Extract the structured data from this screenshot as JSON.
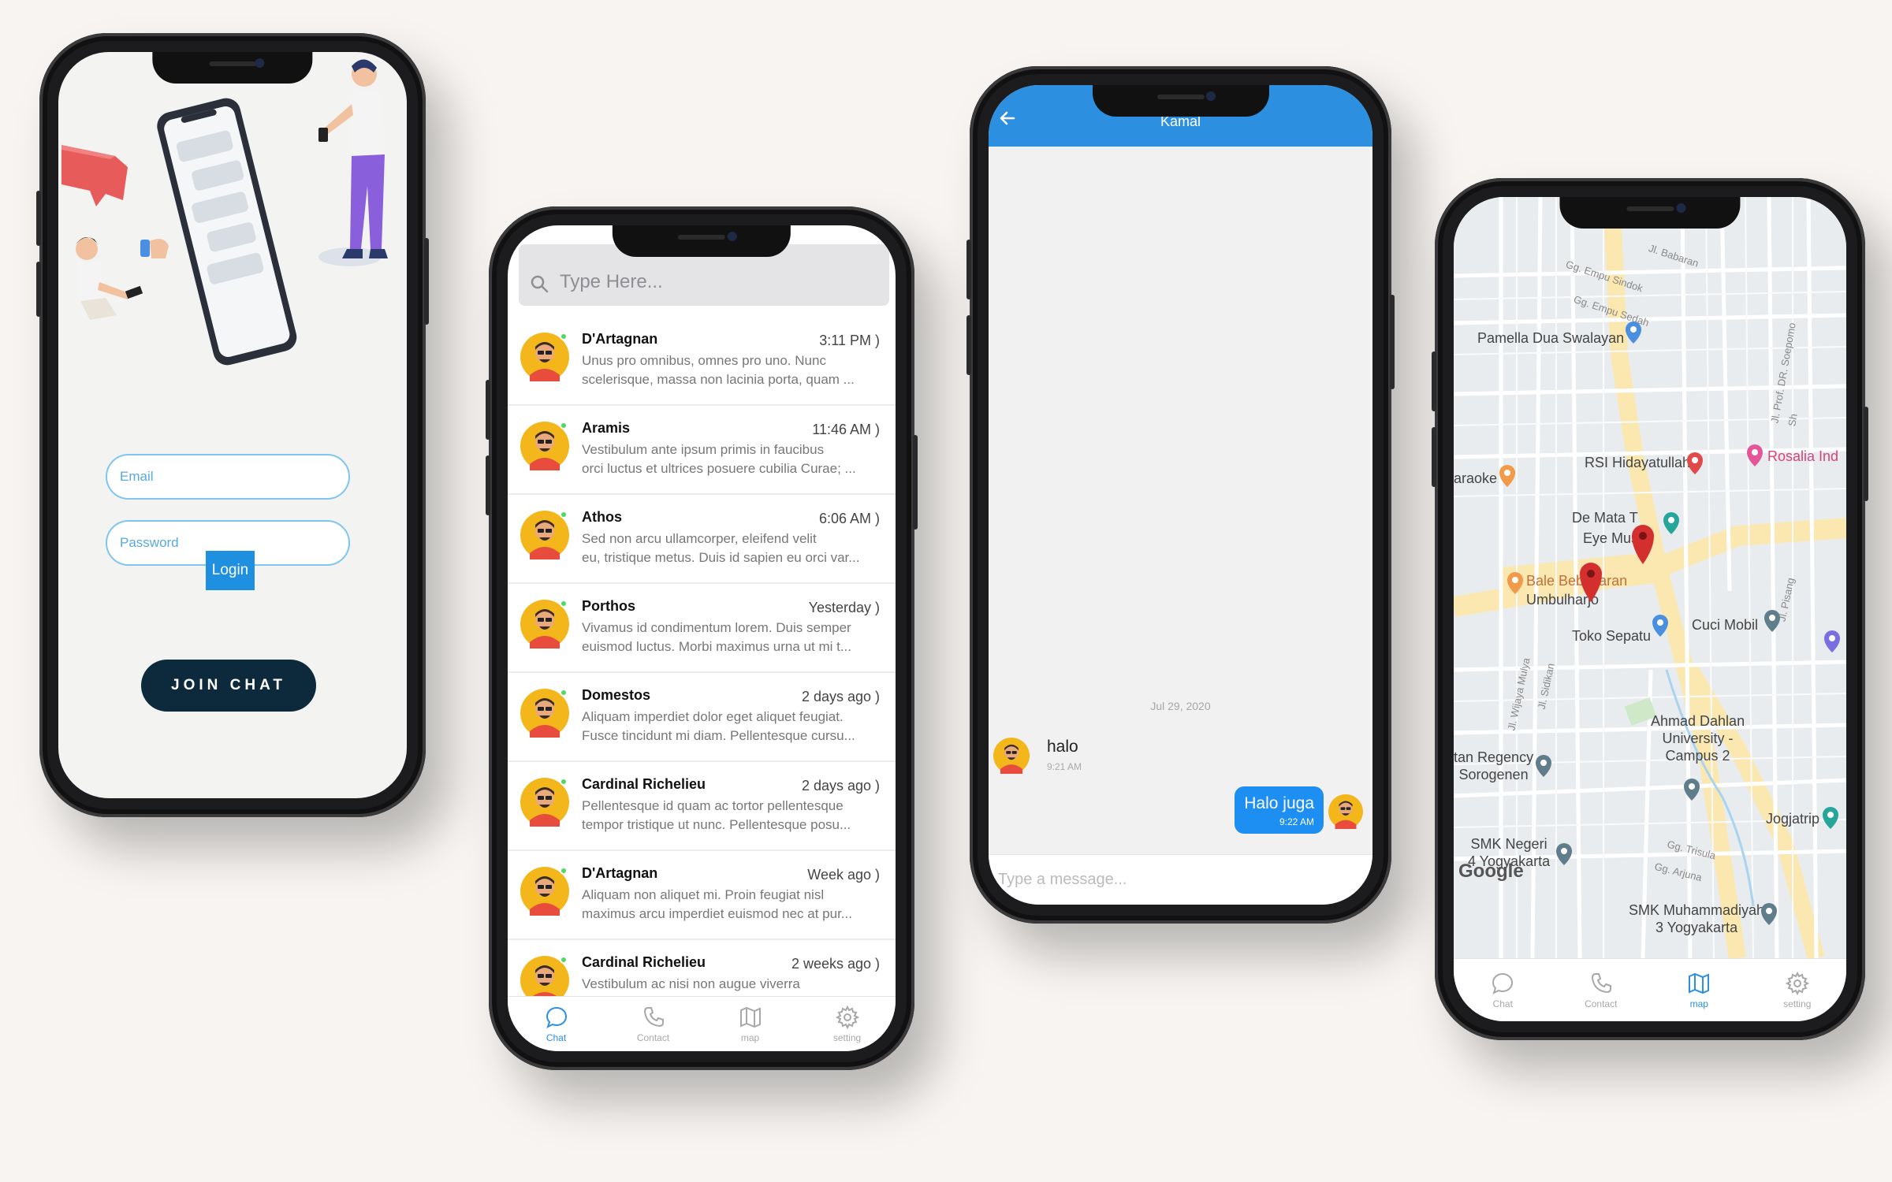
{
  "colors": {
    "primary": "#2c8fe0",
    "join_button": "#0c2a3b",
    "online": "#4cd964",
    "outgoing_bubble": "#1e8ff2",
    "map_pin": "#d32f2f"
  },
  "login": {
    "email_placeholder": "Email",
    "password_placeholder": "Password",
    "login_label": "Login",
    "join_label": "JOIN CHAT"
  },
  "chat_list": {
    "search_placeholder": "Type Here...",
    "items": [
      {
        "name": "D'Artagnan",
        "time": "3:11 PM )",
        "line1": "Unus pro omnibus, omnes pro uno. Nunc",
        "line2": "scelerisque, massa non lacinia porta, quam ..."
      },
      {
        "name": "Aramis",
        "time": "11:46 AM )",
        "line1": "Vestibulum ante ipsum primis in faucibus",
        "line2": "orci luctus et ultrices posuere cubilia Curae; ..."
      },
      {
        "name": "Athos",
        "time": "6:06 AM )",
        "line1": "Sed non arcu ullamcorper, eleifend velit",
        "line2": "eu, tristique metus. Duis id sapien eu orci var..."
      },
      {
        "name": "Porthos",
        "time": "Yesterday )",
        "line1": "Vivamus id condimentum lorem. Duis semper",
        "line2": "euismod luctus. Morbi maximus urna ut mi t..."
      },
      {
        "name": "Domestos",
        "time": "2 days ago )",
        "line1": "Aliquam imperdiet dolor eget aliquet feugiat.",
        "line2": "Fusce tincidunt mi diam. Pellentesque cursu..."
      },
      {
        "name": "Cardinal Richelieu",
        "time": "2 days ago )",
        "line1": "Pellentesque id quam ac tortor pellentesque",
        "line2": "tempor tristique ut nunc. Pellentesque posu..."
      },
      {
        "name": "D'Artagnan",
        "time": "Week ago )",
        "line1": "Aliquam non aliquet mi. Proin feugiat nisl",
        "line2": "maximus arcu imperdiet euismod nec at pur..."
      },
      {
        "name": "Cardinal Richelieu",
        "time": "2 weeks ago )",
        "line1": "Vestibulum ac nisi non augue viverra",
        "line2": ""
      }
    ]
  },
  "tabs": [
    {
      "label": "Chat",
      "icon": "chat-bubble-icon"
    },
    {
      "label": "Contact",
      "icon": "phone-icon"
    },
    {
      "label": "map",
      "icon": "map-icon"
    },
    {
      "label": "setting",
      "icon": "gear-icon"
    }
  ],
  "conversation": {
    "contact_name": "Kamal",
    "date": "Jul 29, 2020",
    "incoming": {
      "text": "halo",
      "time": "9:21 AM"
    },
    "outgoing": {
      "text": "Halo juga",
      "time": "9:22 AM"
    },
    "compose_placeholder": "Type a message..."
  },
  "map": {
    "places": {
      "pamella": "Pamella Dua Swalayan",
      "rsi": "RSI Hidayatullah",
      "rosalia": "Rosalia Ind",
      "karaoke": "araoke",
      "dematat": "De Mata T",
      "eyemuse": "Eye Muse",
      "bale": "Bale Bebakaran",
      "umbulharjo": "Umbulharjo",
      "toko": "Toko Sepatu",
      "cuci": "Cuci Mobil",
      "ahmad1": "Ahmad Dahlan",
      "ahmad2": "University -",
      "ahmad3": "Campus 2",
      "regency1": "tan Regency",
      "regency2": "Sorogenen",
      "jogjatrip": "Jogjatrip",
      "smk1a": "SMK Negeri",
      "smk1b": "4 Yogyakarta",
      "smk2a": "SMK Muhammadiyah",
      "smk2b": "3 Yogyakarta"
    },
    "streets": {
      "s1": "Gg. Empu Sindok",
      "s2": "Gg. Empu Sedah",
      "s3": "Jl. Babaran",
      "s4": "Jl. Prof. DR. Soepomo Sh",
      "s5": "Jl. Sidikan",
      "s6": "Jl. Wijaya Mulya",
      "s7": "Gg. Arjuna",
      "s8": "Gg. Trisula",
      "s9": "Jl. Pisang"
    },
    "attribution": "Google"
  }
}
